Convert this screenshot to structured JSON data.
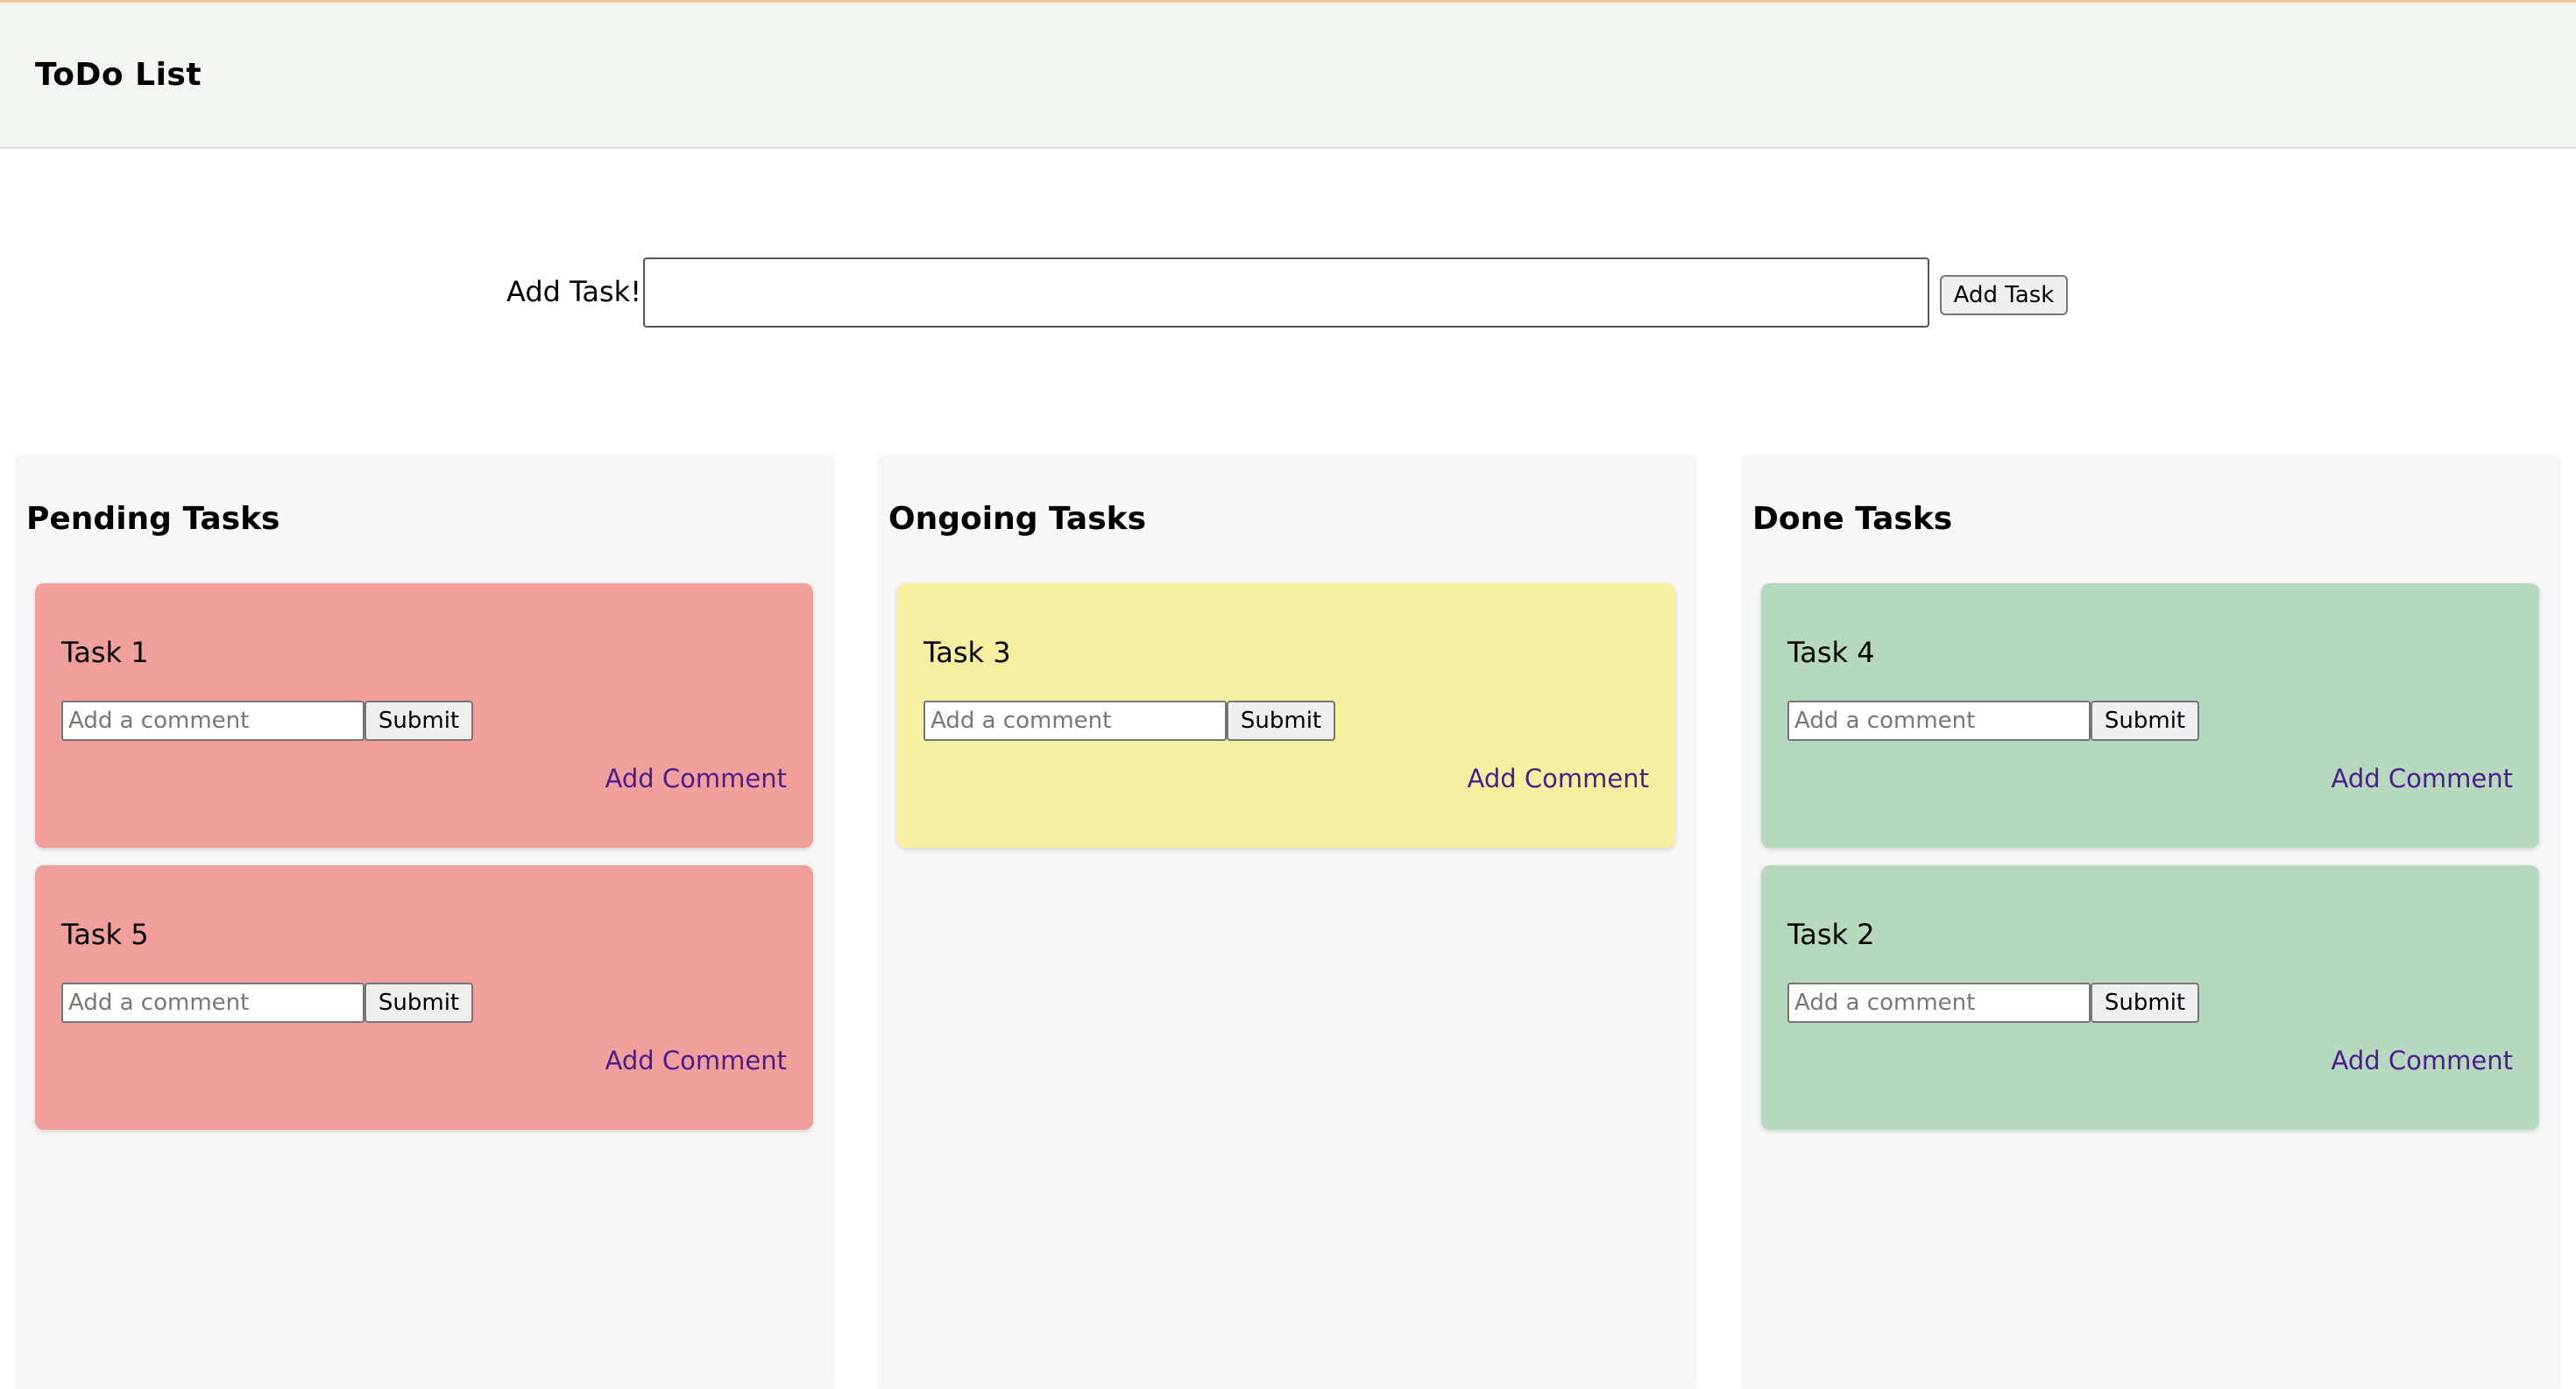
{
  "app": {
    "title": "ToDo List"
  },
  "add_task": {
    "label": "Add Task!",
    "input_value": "",
    "button_label": "Add Task"
  },
  "columns": [
    {
      "title": "Pending Tasks",
      "tasks": [
        {
          "title": "Task 1",
          "comment_placeholder": "Add a comment",
          "submit_label": "Submit",
          "add_comment_label": "Add Comment"
        },
        {
          "title": "Task 5",
          "comment_placeholder": "Add a comment",
          "submit_label": "Submit",
          "add_comment_label": "Add Comment"
        }
      ]
    },
    {
      "title": "Ongoing Tasks",
      "tasks": [
        {
          "title": "Task 3",
          "comment_placeholder": "Add a comment",
          "submit_label": "Submit",
          "add_comment_label": "Add Comment"
        }
      ]
    },
    {
      "title": "Done Tasks",
      "tasks": [
        {
          "title": "Task 4",
          "comment_placeholder": "Add a comment",
          "submit_label": "Submit",
          "add_comment_label": "Add Comment"
        },
        {
          "title": "Task 2",
          "comment_placeholder": "Add a comment",
          "submit_label": "Submit",
          "add_comment_label": "Add Comment"
        }
      ]
    }
  ],
  "colors": {
    "header_bg": "#f1f6ee",
    "pending_card": "#f19f9c",
    "ongoing_card": "#f5ef9f",
    "done_card": "#b5d8be",
    "link": "#4b1d8a"
  }
}
